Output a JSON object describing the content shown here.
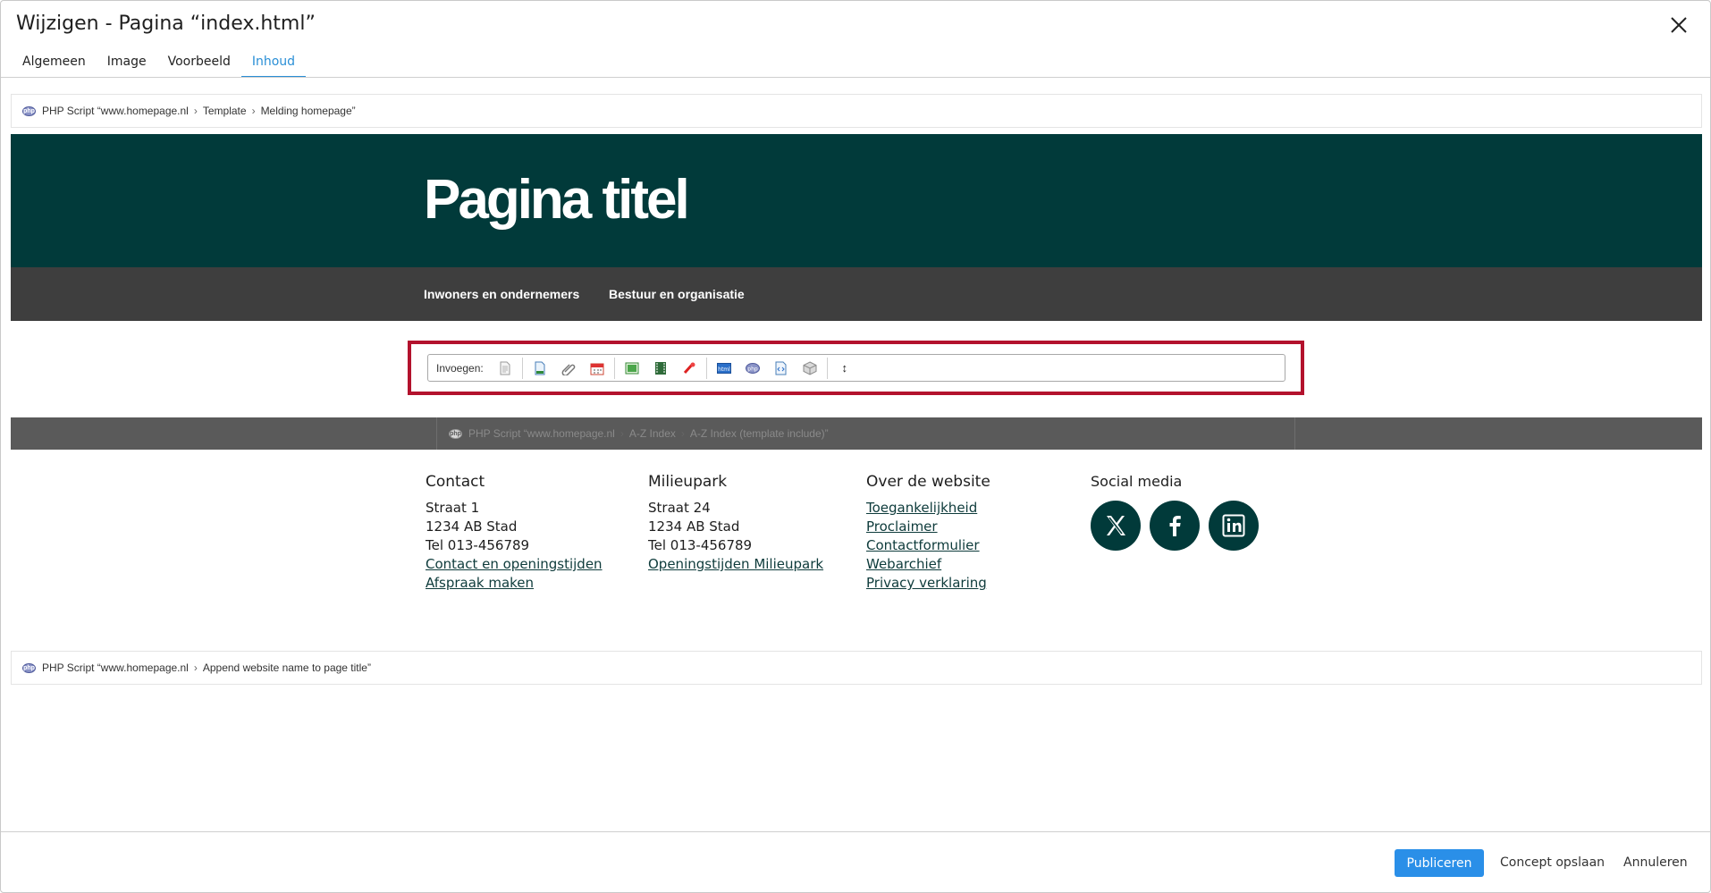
{
  "dialog": {
    "title": "Wijzigen - Pagina “index.html”",
    "tabs": [
      {
        "label": "Algemeen"
      },
      {
        "label": "Image"
      },
      {
        "label": "Voorbeeld"
      },
      {
        "label": "Inhoud",
        "active": true
      }
    ]
  },
  "crumbs": {
    "top": {
      "prefix": "PHP Script “www.homepage.nl",
      "parts": [
        "Template",
        "Melding homepage”"
      ]
    },
    "az": {
      "prefix": "PHP Script “www.homepage.nl",
      "parts": [
        "A-Z Index",
        "A-Z Index (template include)”"
      ]
    },
    "bottom": {
      "prefix": "PHP Script “www.homepage.nl",
      "parts": [
        "Append website name to page title”"
      ]
    },
    "separator": "›",
    "icon_text": "php"
  },
  "preview": {
    "title": "Pagina titel",
    "nav": [
      "Inwoners en ondernemers",
      "Bestuur en organisatie"
    ],
    "colors": {
      "hero": "#013a3a",
      "nav": "#3e3e3e",
      "highlight": "#b3122d"
    }
  },
  "toolbar": {
    "label": "Invoegen:",
    "buttons": [
      "page-icon",
      "document-icon",
      "attachment-icon",
      "calendar-icon",
      "image-icon",
      "film-icon",
      "pdf-icon",
      "html-icon",
      "php-icon",
      "code-icon",
      "box-icon",
      "line-break-icon"
    ],
    "resize_glyph": "↕"
  },
  "footer": {
    "contact": {
      "heading": "Contact",
      "lines": [
        "Straat 1",
        "1234 AB  Stad",
        "Tel 013-456789"
      ],
      "links": [
        "Contact en openingstijden",
        "Afspraak maken"
      ]
    },
    "milieupark": {
      "heading": "Milieupark",
      "lines": [
        "Straat 24",
        "1234 AB  Stad",
        "Tel 013-456789"
      ],
      "links": [
        "Openingstijden Milieupark"
      ]
    },
    "website": {
      "heading": "Over de website",
      "links": [
        "Toegankelijkheid",
        "Proclaimer",
        "Contactformulier",
        "Webarchief",
        "Privacy verklaring"
      ]
    },
    "social": {
      "heading": "Social media",
      "icons": [
        "x-icon",
        "facebook-icon",
        "linkedin-icon"
      ]
    }
  },
  "actions": {
    "publish": "Publiceren",
    "draft": "Concept opslaan",
    "cancel": "Annuleren"
  }
}
